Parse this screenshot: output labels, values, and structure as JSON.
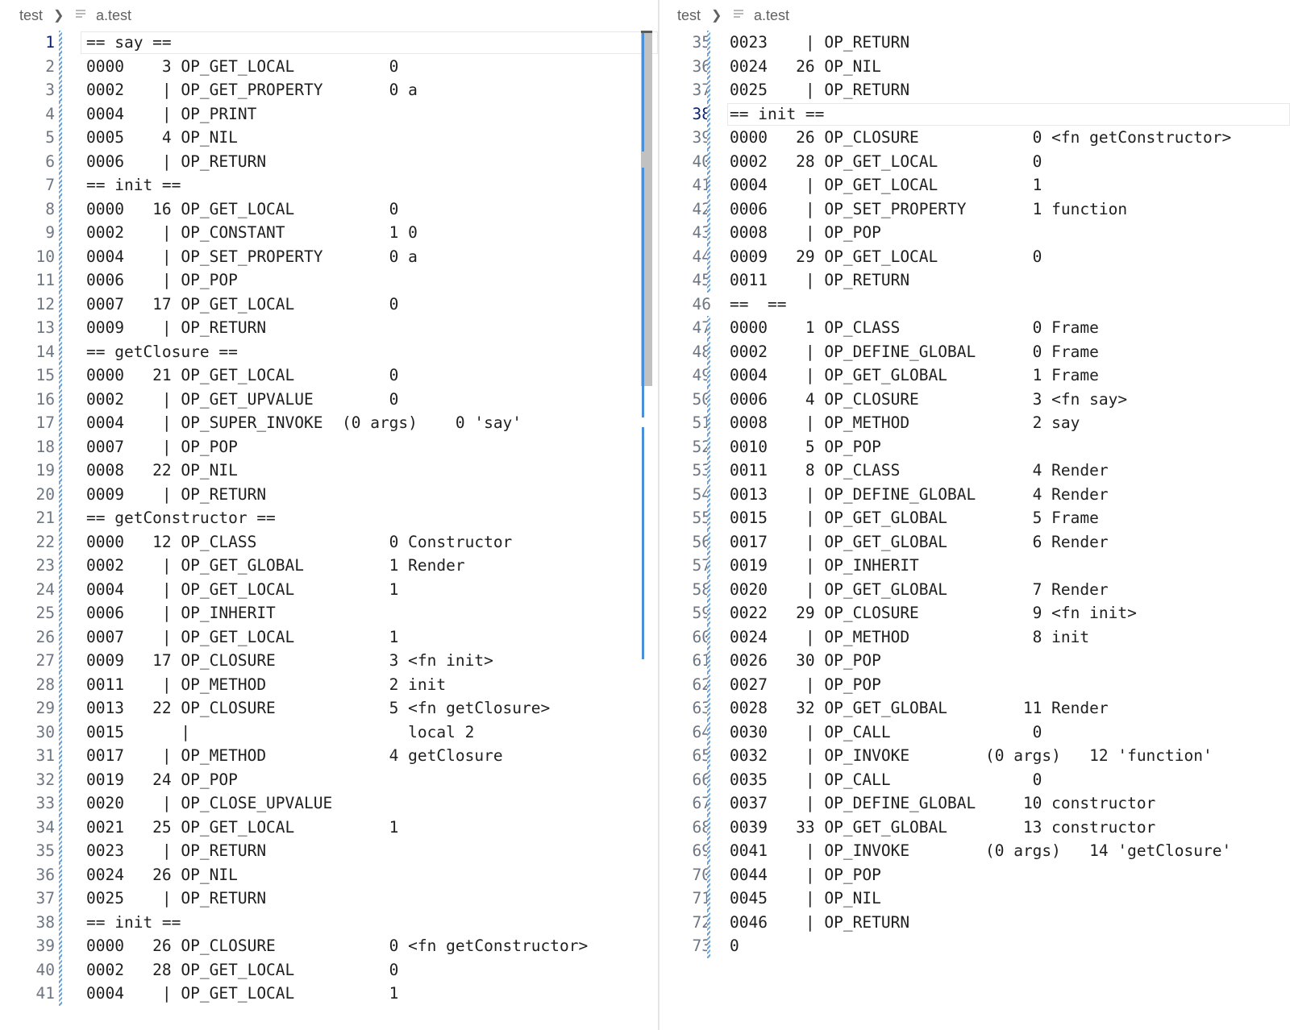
{
  "left_pane": {
    "breadcrumb": {
      "folder": "test",
      "file": "a.test"
    },
    "current_line": 1,
    "lines": [
      {
        "n": "1",
        "t": "== say =="
      },
      {
        "n": "2",
        "t": "0000    3 OP_GET_LOCAL          0"
      },
      {
        "n": "3",
        "t": "0002    | OP_GET_PROPERTY       0 a"
      },
      {
        "n": "4",
        "t": "0004    | OP_PRINT"
      },
      {
        "n": "5",
        "t": "0005    4 OP_NIL"
      },
      {
        "n": "6",
        "t": "0006    | OP_RETURN"
      },
      {
        "n": "7",
        "t": "== init =="
      },
      {
        "n": "8",
        "t": "0000   16 OP_GET_LOCAL          0"
      },
      {
        "n": "9",
        "t": "0002    | OP_CONSTANT           1 0"
      },
      {
        "n": "10",
        "t": "0004    | OP_SET_PROPERTY       0 a"
      },
      {
        "n": "11",
        "t": "0006    | OP_POP"
      },
      {
        "n": "12",
        "t": "0007   17 OP_GET_LOCAL          0"
      },
      {
        "n": "13",
        "t": "0009    | OP_RETURN"
      },
      {
        "n": "14",
        "t": "== getClosure =="
      },
      {
        "n": "15",
        "t": "0000   21 OP_GET_LOCAL          0"
      },
      {
        "n": "16",
        "t": "0002    | OP_GET_UPVALUE        0"
      },
      {
        "n": "17",
        "t": "0004    | OP_SUPER_INVOKE  (0 args)    0 'say'"
      },
      {
        "n": "18",
        "t": "0007    | OP_POP"
      },
      {
        "n": "19",
        "t": "0008   22 OP_NIL"
      },
      {
        "n": "20",
        "t": "0009    | OP_RETURN"
      },
      {
        "n": "21",
        "t": "== getConstructor =="
      },
      {
        "n": "22",
        "t": "0000   12 OP_CLASS              0 Constructor"
      },
      {
        "n": "23",
        "t": "0002    | OP_GET_GLOBAL         1 Render"
      },
      {
        "n": "24",
        "t": "0004    | OP_GET_LOCAL          1"
      },
      {
        "n": "25",
        "t": "0006    | OP_INHERIT"
      },
      {
        "n": "26",
        "t": "0007    | OP_GET_LOCAL          1"
      },
      {
        "n": "27",
        "t": "0009   17 OP_CLOSURE            3 <fn init>"
      },
      {
        "n": "28",
        "t": "0011    | OP_METHOD             2 init"
      },
      {
        "n": "29",
        "t": "0013   22 OP_CLOSURE            5 <fn getClosure>"
      },
      {
        "n": "30",
        "t": "0015      |                       local 2"
      },
      {
        "n": "31",
        "t": "0017    | OP_METHOD             4 getClosure"
      },
      {
        "n": "32",
        "t": "0019   24 OP_POP"
      },
      {
        "n": "33",
        "t": "0020    | OP_CLOSE_UPVALUE"
      },
      {
        "n": "34",
        "t": "0021   25 OP_GET_LOCAL          1"
      },
      {
        "n": "35",
        "t": "0023    | OP_RETURN"
      },
      {
        "n": "36",
        "t": "0024   26 OP_NIL"
      },
      {
        "n": "37",
        "t": "0025    | OP_RETURN"
      },
      {
        "n": "38",
        "t": "== init =="
      },
      {
        "n": "39",
        "t": "0000   26 OP_CLOSURE            0 <fn getConstructor>"
      },
      {
        "n": "40",
        "t": "0002   28 OP_GET_LOCAL          0"
      },
      {
        "n": "41",
        "t": "0004    | OP_GET_LOCAL          1"
      }
    ]
  },
  "right_pane": {
    "breadcrumb": {
      "folder": "test",
      "file": "a.test"
    },
    "current_line": 38,
    "lines": [
      {
        "n": "35",
        "t": "0023    | OP_RETURN"
      },
      {
        "n": "36",
        "t": "0024   26 OP_NIL"
      },
      {
        "n": "37",
        "t": "0025    | OP_RETURN"
      },
      {
        "n": "38",
        "t": "== init =="
      },
      {
        "n": "39",
        "t": "0000   26 OP_CLOSURE            0 <fn getConstructor>"
      },
      {
        "n": "40",
        "t": "0002   28 OP_GET_LOCAL          0"
      },
      {
        "n": "41",
        "t": "0004    | OP_GET_LOCAL          1"
      },
      {
        "n": "42",
        "t": "0006    | OP_SET_PROPERTY       1 function"
      },
      {
        "n": "43",
        "t": "0008    | OP_POP"
      },
      {
        "n": "44",
        "t": "0009   29 OP_GET_LOCAL          0"
      },
      {
        "n": "45",
        "t": "0011    | OP_RETURN"
      },
      {
        "n": "46",
        "t": "==  =="
      },
      {
        "n": "47",
        "t": "0000    1 OP_CLASS              0 Frame"
      },
      {
        "n": "48",
        "t": "0002    | OP_DEFINE_GLOBAL      0 Frame"
      },
      {
        "n": "49",
        "t": "0004    | OP_GET_GLOBAL         1 Frame"
      },
      {
        "n": "50",
        "t": "0006    4 OP_CLOSURE            3 <fn say>"
      },
      {
        "n": "51",
        "t": "0008    | OP_METHOD             2 say"
      },
      {
        "n": "52",
        "t": "0010    5 OP_POP"
      },
      {
        "n": "53",
        "t": "0011    8 OP_CLASS              4 Render"
      },
      {
        "n": "54",
        "t": "0013    | OP_DEFINE_GLOBAL      4 Render"
      },
      {
        "n": "55",
        "t": "0015    | OP_GET_GLOBAL         5 Frame"
      },
      {
        "n": "56",
        "t": "0017    | OP_GET_GLOBAL         6 Render"
      },
      {
        "n": "57",
        "t": "0019    | OP_INHERIT"
      },
      {
        "n": "58",
        "t": "0020    | OP_GET_GLOBAL         7 Render"
      },
      {
        "n": "59",
        "t": "0022   29 OP_CLOSURE            9 <fn init>"
      },
      {
        "n": "60",
        "t": "0024    | OP_METHOD             8 init"
      },
      {
        "n": "61",
        "t": "0026   30 OP_POP"
      },
      {
        "n": "62",
        "t": "0027    | OP_POP"
      },
      {
        "n": "63",
        "t": "0028   32 OP_GET_GLOBAL        11 Render"
      },
      {
        "n": "64",
        "t": "0030    | OP_CALL               0"
      },
      {
        "n": "65",
        "t": "0032    | OP_INVOKE        (0 args)   12 'function'"
      },
      {
        "n": "66",
        "t": "0035    | OP_CALL               0"
      },
      {
        "n": "67",
        "t": "0037    | OP_DEFINE_GLOBAL     10 constructor"
      },
      {
        "n": "68",
        "t": "0039   33 OP_GET_GLOBAL        13 constructor"
      },
      {
        "n": "69",
        "t": "0041    | OP_INVOKE        (0 args)   14 'getClosure'"
      },
      {
        "n": "70",
        "t": "0044    | OP_POP"
      },
      {
        "n": "71",
        "t": "0045    | OP_NIL"
      },
      {
        "n": "72",
        "t": "0046    | OP_RETURN"
      },
      {
        "n": "73",
        "t": "0"
      }
    ]
  }
}
